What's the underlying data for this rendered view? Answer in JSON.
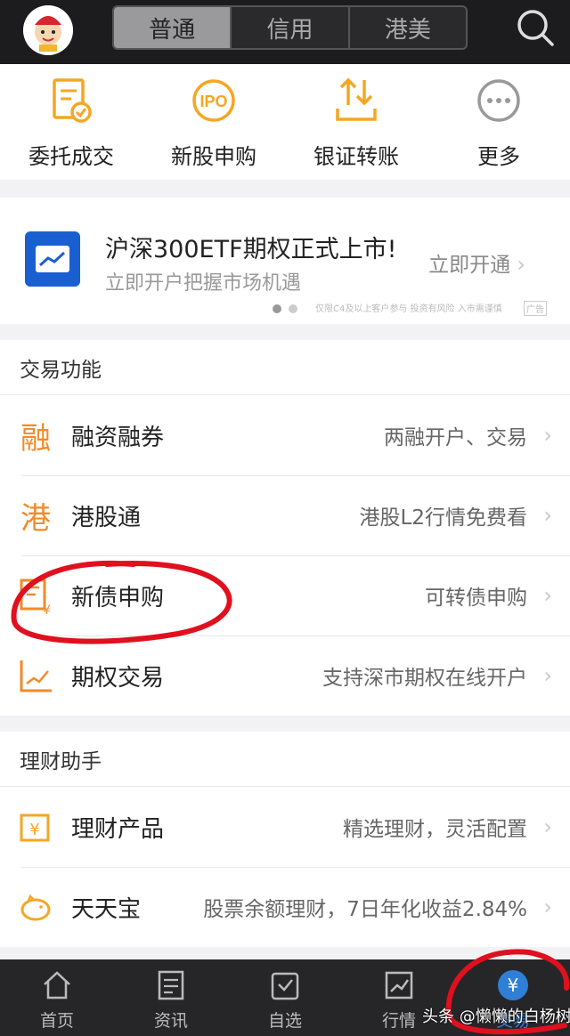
{
  "header": {
    "tabs": [
      {
        "label": "普通",
        "active": true
      },
      {
        "label": "信用",
        "active": false
      },
      {
        "label": "港美",
        "active": false
      }
    ],
    "search_icon": "search-icon"
  },
  "quick_actions": [
    {
      "label": "委托成交",
      "icon": "order-icon"
    },
    {
      "label": "新股申购",
      "icon": "ipo-icon"
    },
    {
      "label": "银证转账",
      "icon": "transfer-icon"
    },
    {
      "label": "更多",
      "icon": "more-icon"
    }
  ],
  "banner": {
    "title": "沪深300ETF期权正式上市!",
    "subtitle": "立即开户把握市场机遇",
    "link": "立即开通",
    "note": "仅限C4及以上客户参与 投资有风险 入市需谨慎",
    "ad_tag": "广告"
  },
  "trade_section": {
    "heading": "交易功能",
    "rows": [
      {
        "icon_char": "融",
        "title": "融资融券",
        "desc": "两融开户、交易"
      },
      {
        "icon_char": "港",
        "title": "港股通",
        "desc": "港股L2行情免费看"
      },
      {
        "icon_char": "",
        "title": "新债申购",
        "desc": "可转债申购"
      },
      {
        "icon_char": "",
        "title": "期权交易",
        "desc": "支持深市期权在线开户"
      }
    ]
  },
  "finance_section": {
    "heading": "理财助手",
    "rows": [
      {
        "title": "理财产品",
        "desc": "精选理财，灵活配置"
      },
      {
        "title": "天天宝",
        "desc": "股票余额理财，7日年化收益2.84%"
      }
    ]
  },
  "bottom_nav": [
    {
      "label": "首页",
      "icon": "home-icon",
      "active": false
    },
    {
      "label": "资讯",
      "icon": "news-icon",
      "active": false
    },
    {
      "label": "自选",
      "icon": "watchlist-icon",
      "active": false
    },
    {
      "label": "行情",
      "icon": "market-icon",
      "active": false
    },
    {
      "label": "交易",
      "icon": "yen-icon",
      "active": true
    }
  ],
  "watermark": "头条 @懒懒的白杨树",
  "colors": {
    "accent": "#f08b2a",
    "active_blue": "#2f7fd6",
    "annotation_red": "#e0101e"
  }
}
